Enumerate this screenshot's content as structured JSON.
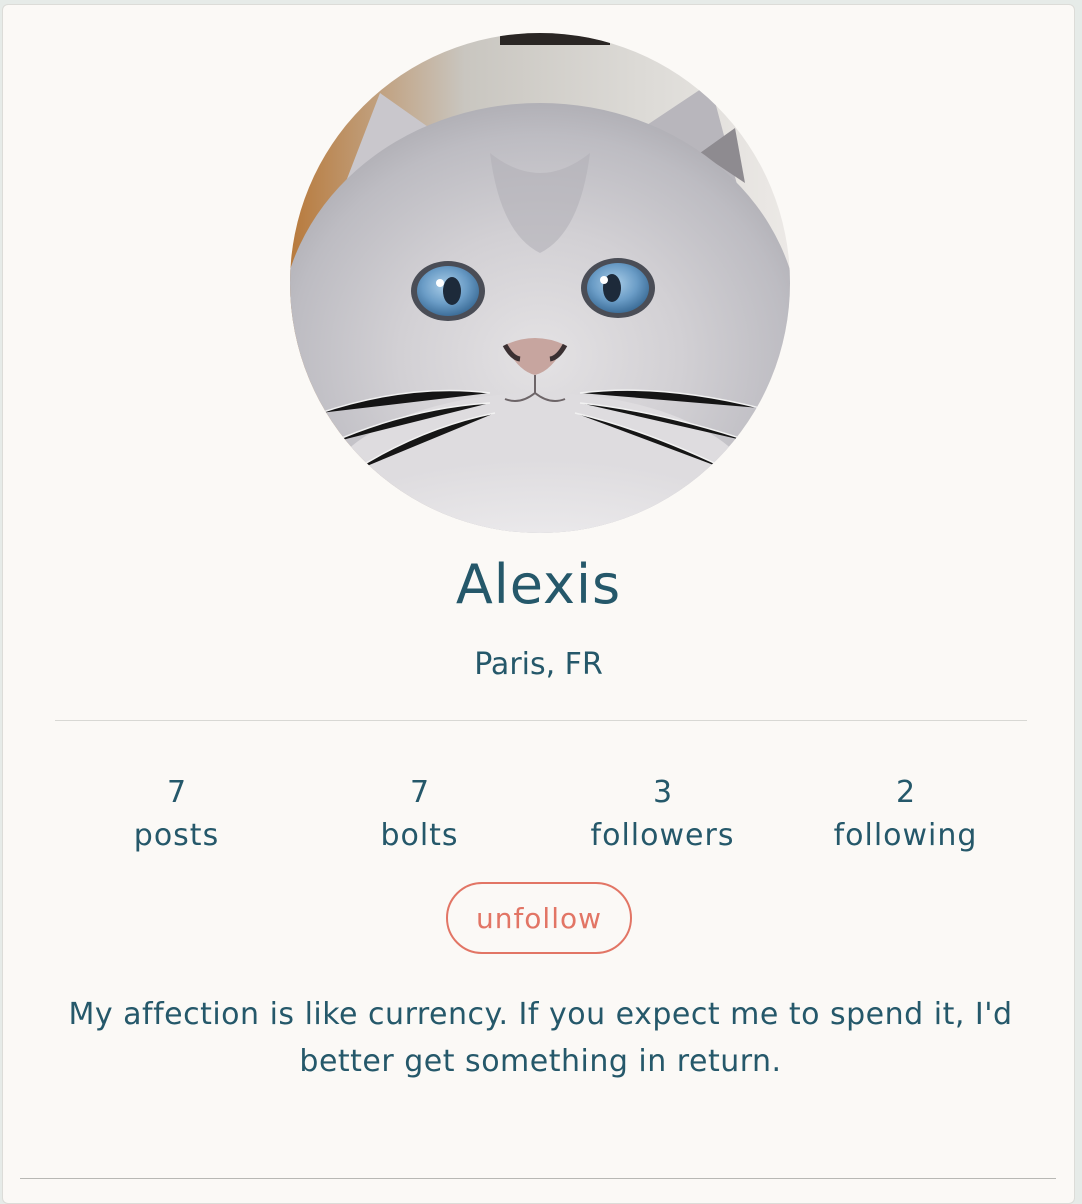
{
  "profile": {
    "name": "Alexis",
    "location": "Paris, FR",
    "bio": "My affection is like currency. If you expect me to spend it, I'd better get something in return."
  },
  "stats": [
    {
      "value": "7",
      "label": "posts"
    },
    {
      "value": "7",
      "label": "bolts"
    },
    {
      "value": "3",
      "label": "followers"
    },
    {
      "value": "2",
      "label": "following"
    }
  ],
  "actions": {
    "unfollow_label": "unfollow"
  },
  "colors": {
    "text": "#25586a",
    "accent": "#e27565",
    "card_background": "#fbf9f6"
  }
}
